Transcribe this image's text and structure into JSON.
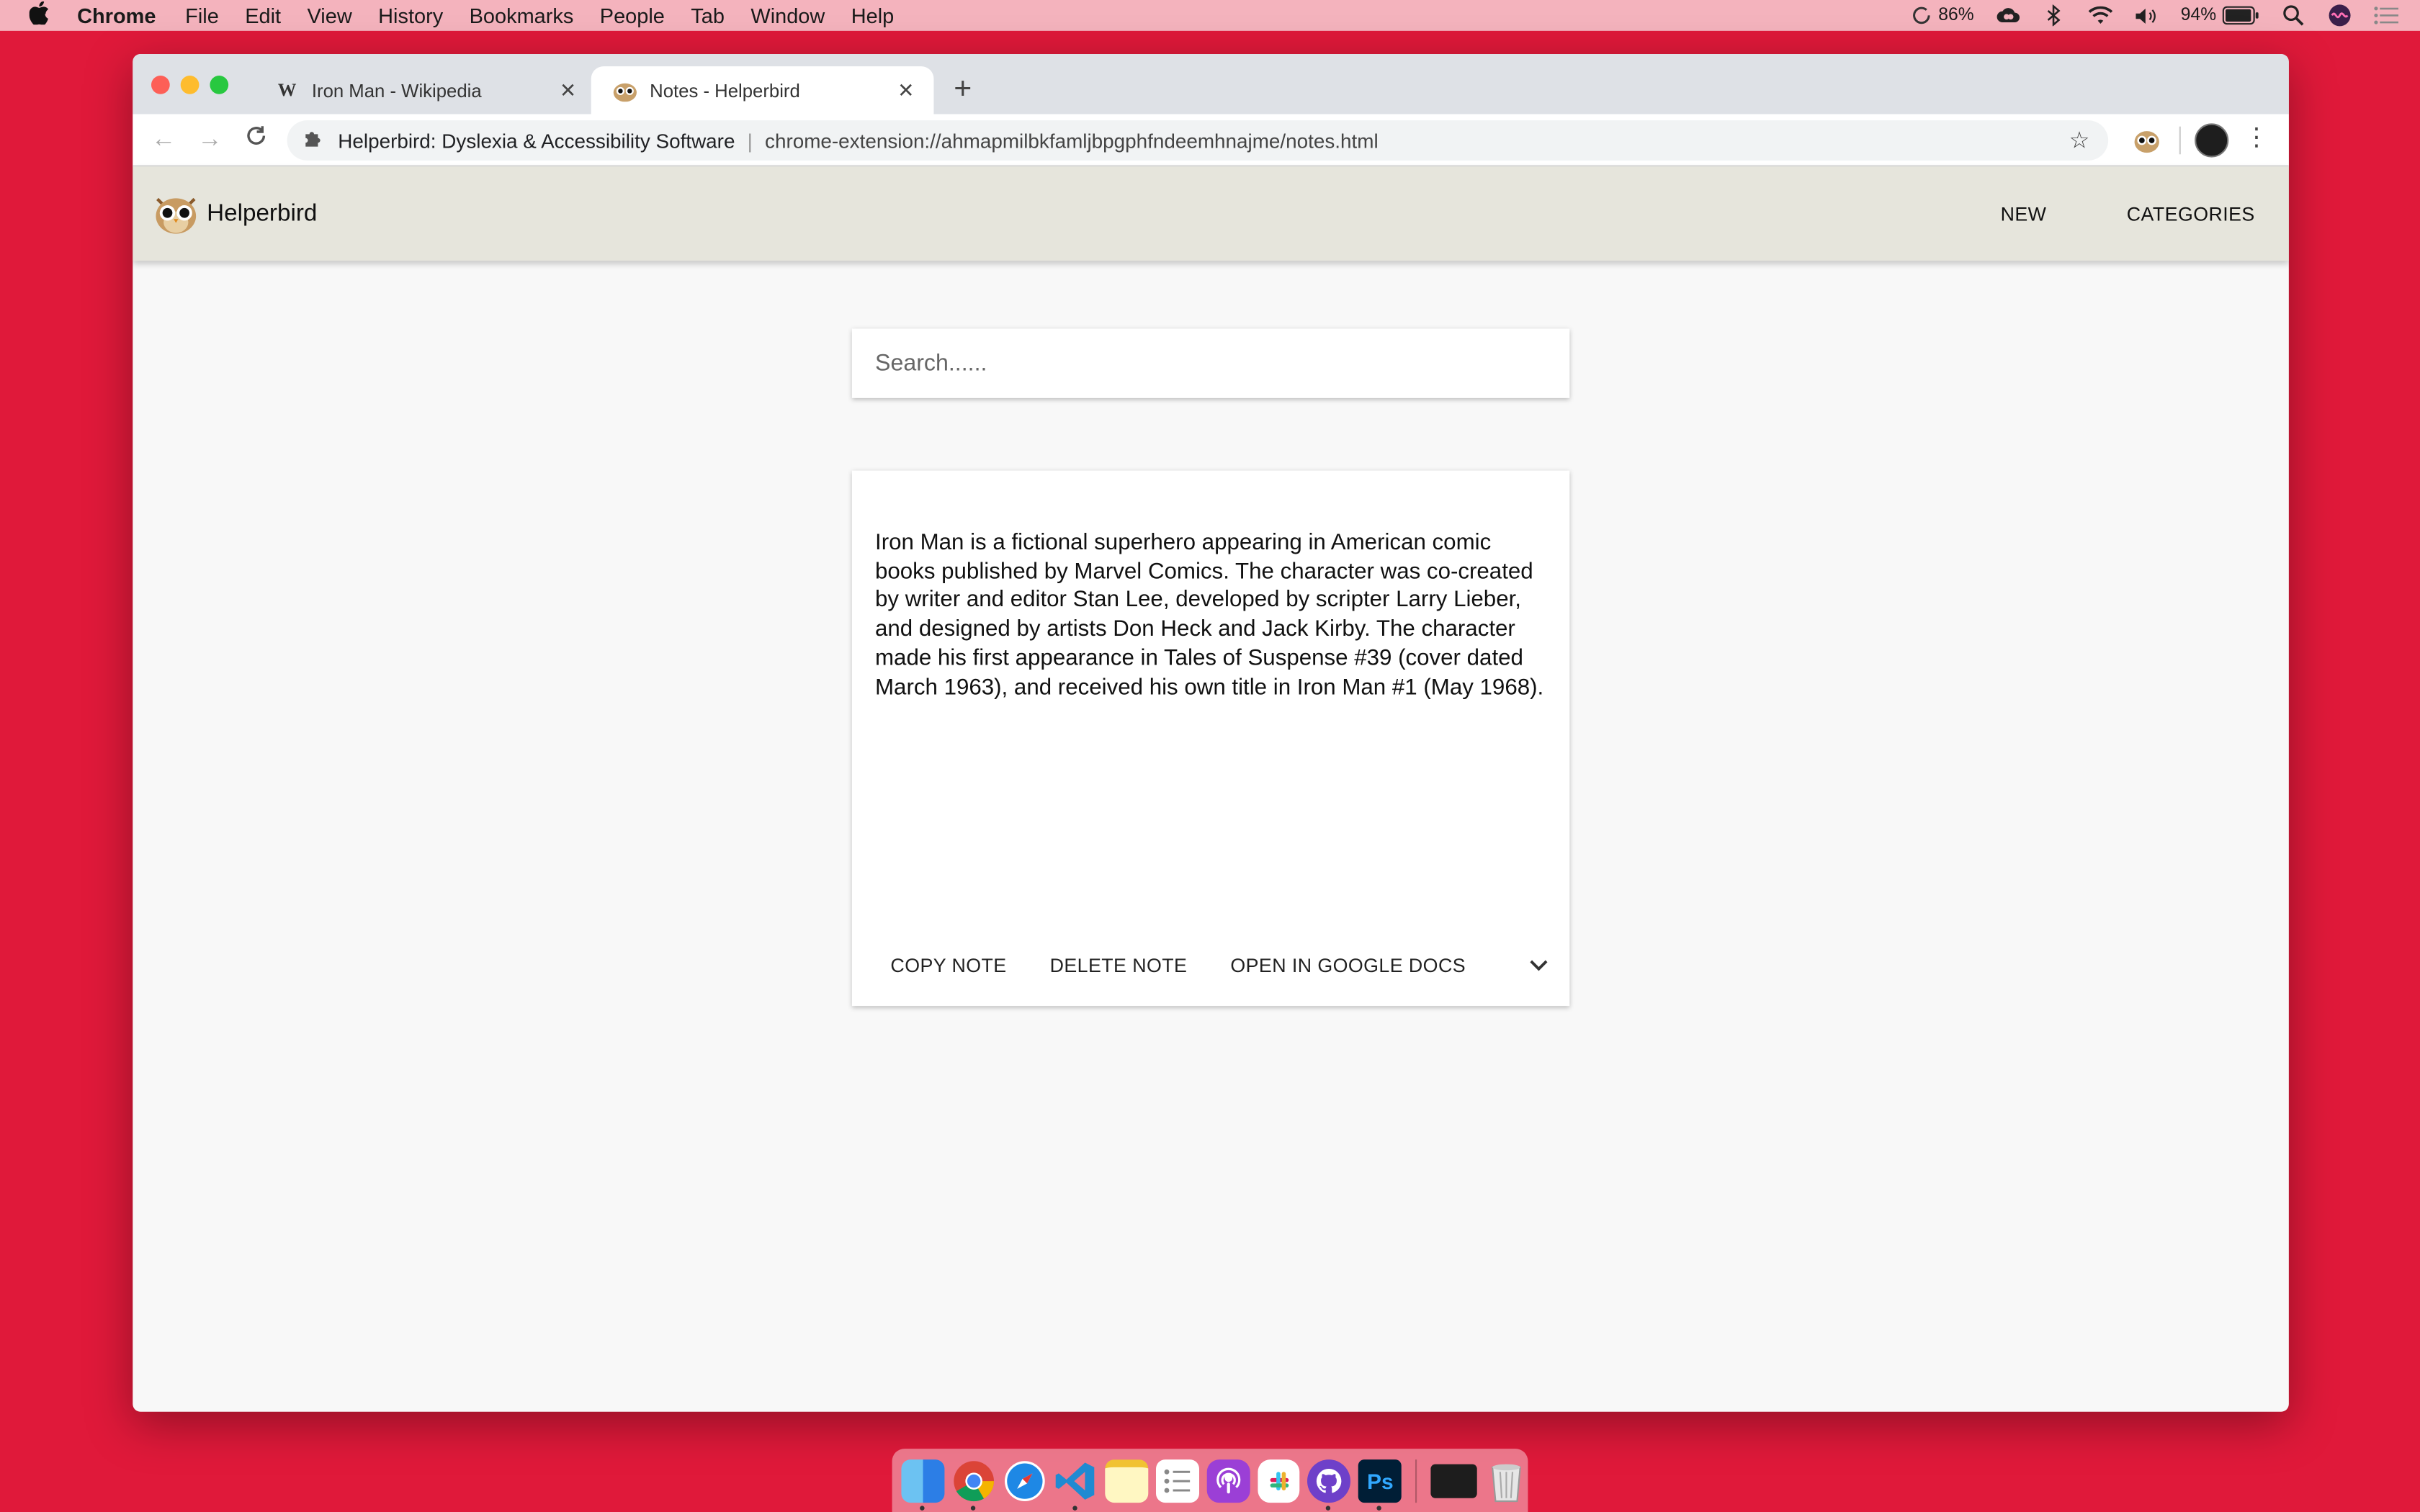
{
  "menubar": {
    "app": "Chrome",
    "items": [
      "File",
      "Edit",
      "View",
      "History",
      "Bookmarks",
      "People",
      "Tab",
      "Window",
      "Help"
    ],
    "status": {
      "cpu": "86%",
      "battery": "94%"
    }
  },
  "browser": {
    "tabs": [
      {
        "title": "Iron Man - Wikipedia",
        "favicon": "W"
      },
      {
        "title": "Notes - Helperbird"
      }
    ],
    "omnibox": {
      "origin": "Helperbird: Dyslexia & Accessibility Software",
      "url": "chrome-extension://ahmapmilbkfamljbpgphfndeemhnajme/notes.html"
    }
  },
  "app": {
    "brand": "Helperbird",
    "nav": {
      "new": "NEW",
      "categories": "CATEGORIES"
    },
    "search": {
      "placeholder": "Search......"
    },
    "note": {
      "text": "Iron Man is a fictional superhero appearing in American comic books published by Marvel Comics. The character was co-created by writer and editor Stan Lee, developed by scripter Larry Lieber, and designed by artists Don Heck and Jack Kirby. The character made his first appearance in Tales of Suspense #39 (cover dated March 1963), and received his own title in Iron Man #1 (May 1968).",
      "actions": {
        "copy": "COPY NOTE",
        "delete": "DELETE NOTE",
        "open": "OPEN IN GOOGLE DOCS"
      }
    }
  },
  "dock": {
    "apps": [
      "finder-icon",
      "chrome-icon",
      "safari-icon",
      "vscode-icon",
      "notes-icon",
      "reminders-icon",
      "podcasts-icon",
      "slack-icon",
      "github-icon",
      "photoshop-icon",
      "terminal-icon",
      "trash-icon"
    ],
    "photoshop_label": "Ps"
  },
  "colors": {
    "desktop": "#e0193a",
    "menubar": "#f4b3bd",
    "appbar": "#e6e5dc"
  }
}
